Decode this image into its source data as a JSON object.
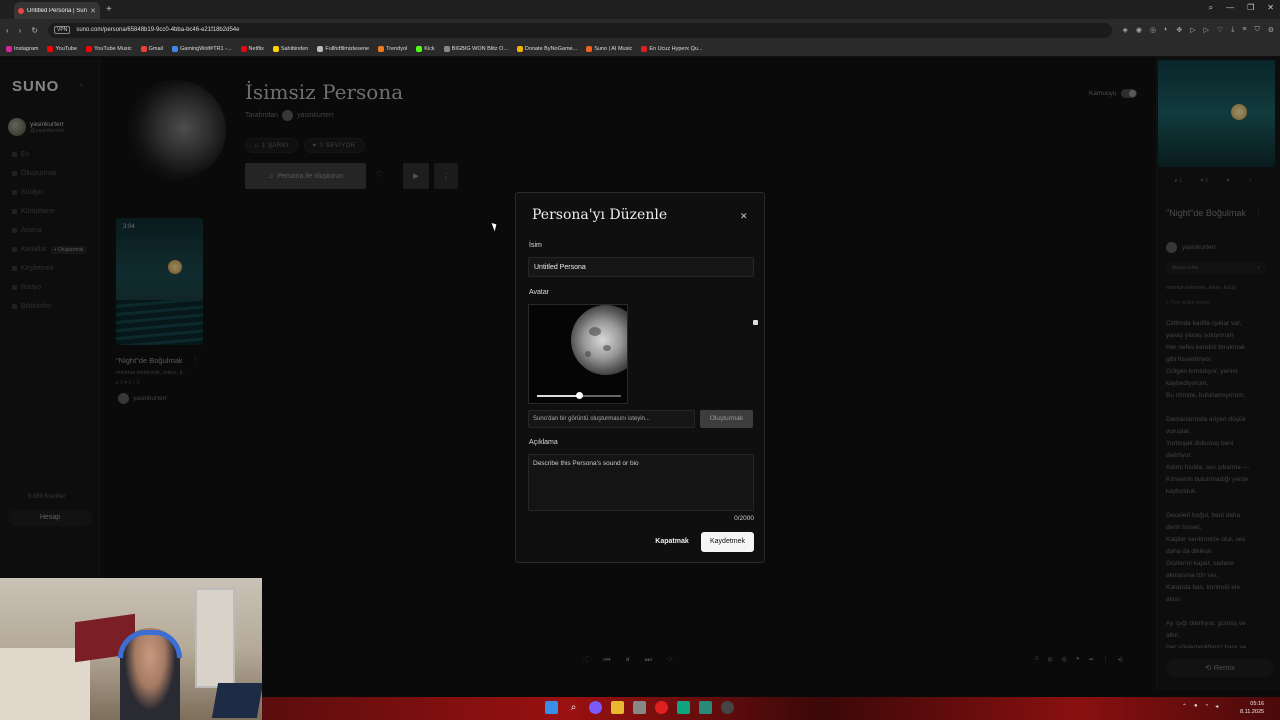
{
  "browser": {
    "tab_title": "Untitled Persona | Suno",
    "url": "suno.com/persona/65848b19-9cc0-4bba-bc46-e21f18b2d54e",
    "vpn": "VPN",
    "bookmarks": [
      {
        "label": "Instagram",
        "color": "#d6249f"
      },
      {
        "label": "YouTube",
        "color": "#ff0000"
      },
      {
        "label": "YouTube Music",
        "color": "#ff0000"
      },
      {
        "label": "Gmail",
        "color": "#ea4335"
      },
      {
        "label": "GamingWolf#TR1 -...",
        "color": "#4285f4"
      },
      {
        "label": "Netflix",
        "color": "#e50914"
      },
      {
        "label": "Sahibinden",
        "color": "#ffd400"
      },
      {
        "label": "Fullhdfilmizlesene",
        "color": "#bbbbbb"
      },
      {
        "label": "Trendyol",
        "color": "#f27a1a"
      },
      {
        "label": "Kick",
        "color": "#53fc18"
      },
      {
        "label": "BIGBIG WON Blitz O...",
        "color": "#888888"
      },
      {
        "label": "Donate ByNoGame...",
        "color": "#f0b400"
      },
      {
        "label": "Suno | AI Music",
        "color": "#f06020"
      },
      {
        "label": "En Ucuz Hyperx Qu...",
        "color": "#e02020"
      }
    ]
  },
  "sidebar": {
    "logo": "SUNO",
    "user": {
      "name": "yasinkurterr",
      "handle": "@yasinkurterr"
    },
    "nav": [
      {
        "label": "Ev"
      },
      {
        "label": "Oluşturmak"
      },
      {
        "label": "Stüdyo"
      },
      {
        "label": "Kütüphane"
      },
      {
        "label": "Arama"
      },
      {
        "label": "Kanallar",
        "badge": "+ Oluşturmak"
      },
      {
        "label": "Keşfetmek"
      },
      {
        "label": "Radyo"
      },
      {
        "label": "Bildirimler"
      }
    ],
    "credits": "9.980 Krediler",
    "account_button": "Hesap"
  },
  "persona": {
    "title": "İsimsiz Persona",
    "by_label": "Tarafından",
    "owner": "yasinkurterr",
    "songs_chip": "1 ŞARKI",
    "likes_chip": "0 SEVIYOR",
    "create_button": "Persona ile oluşturun",
    "public_label": "Kamuoyu"
  },
  "song_card": {
    "duration": "3:04",
    "title": "\"Night\"de Boğulmak",
    "tags": "minimal elektronik, tekno, k...",
    "stats": "▸ 1  ♥ 0  ⌕ 0",
    "user": "yasinkurterr"
  },
  "modal": {
    "title": "Persona'yı Düzenle",
    "name_label": "İsim",
    "name_value": "Untitled Persona",
    "avatar_label": "Avatar",
    "avatar_zoom": 0.5,
    "image_prompt_placeholder": "Suno'dan bir görüntü oluşturmasını isteyin...",
    "generate_button": "Oluşturmak",
    "description_label": "Açıklama",
    "description_placeholder": "Describe this Persona's sound or bio",
    "counter": "0/2000",
    "cancel_button": "Kapatmak",
    "save_button": "Kaydetmek"
  },
  "right_panel": {
    "stats": [
      "▸ 1",
      "♥ 0",
      "♥",
      "↗"
    ],
    "song_title": "\"Night\"de Boğulmak",
    "user": "yasinkurterr",
    "alt_label": "Altyazı Ekle",
    "tags": "minimal elektronik, tekno, kulüp",
    "show_styles": "+ Tüm stilleri göster",
    "lyrics": "Ciltlimde kadife ışıklar var,\nyavaş yavaş soluyorum\nHer nefes kendini bırakmak\ngibi hissettiriyor.\nGölgen kımıldıyor, yerimi\nkaybediyorum,\nBu ritimde, bulunamıyorum.\n\nDamarlarımda eriyen düşük\nvuruşlar,\nYumuşak dokunuş beni\ndelirtiyor.\nAdımı fısılda, ses çıkarma —\nKimsenin bulunmadığı yerde\nkaybolduk.\n\nGeceleri boğul, beni daha\nderin hisset,\nKalpler senkronize olur, ses\ndaha da dikleşir.\nGözlerini kapat, sadece\nakmasına izin ver,\nKaranda bas, kontrolü ele\nalsın.\n\nAy ışığı damlıyor, gümüş ve\naltın,\nHer söylemediğimiz hara ve",
    "remix_button": "Remix"
  },
  "taskbar": {
    "time": "05:16",
    "date": "8.11.2025"
  }
}
